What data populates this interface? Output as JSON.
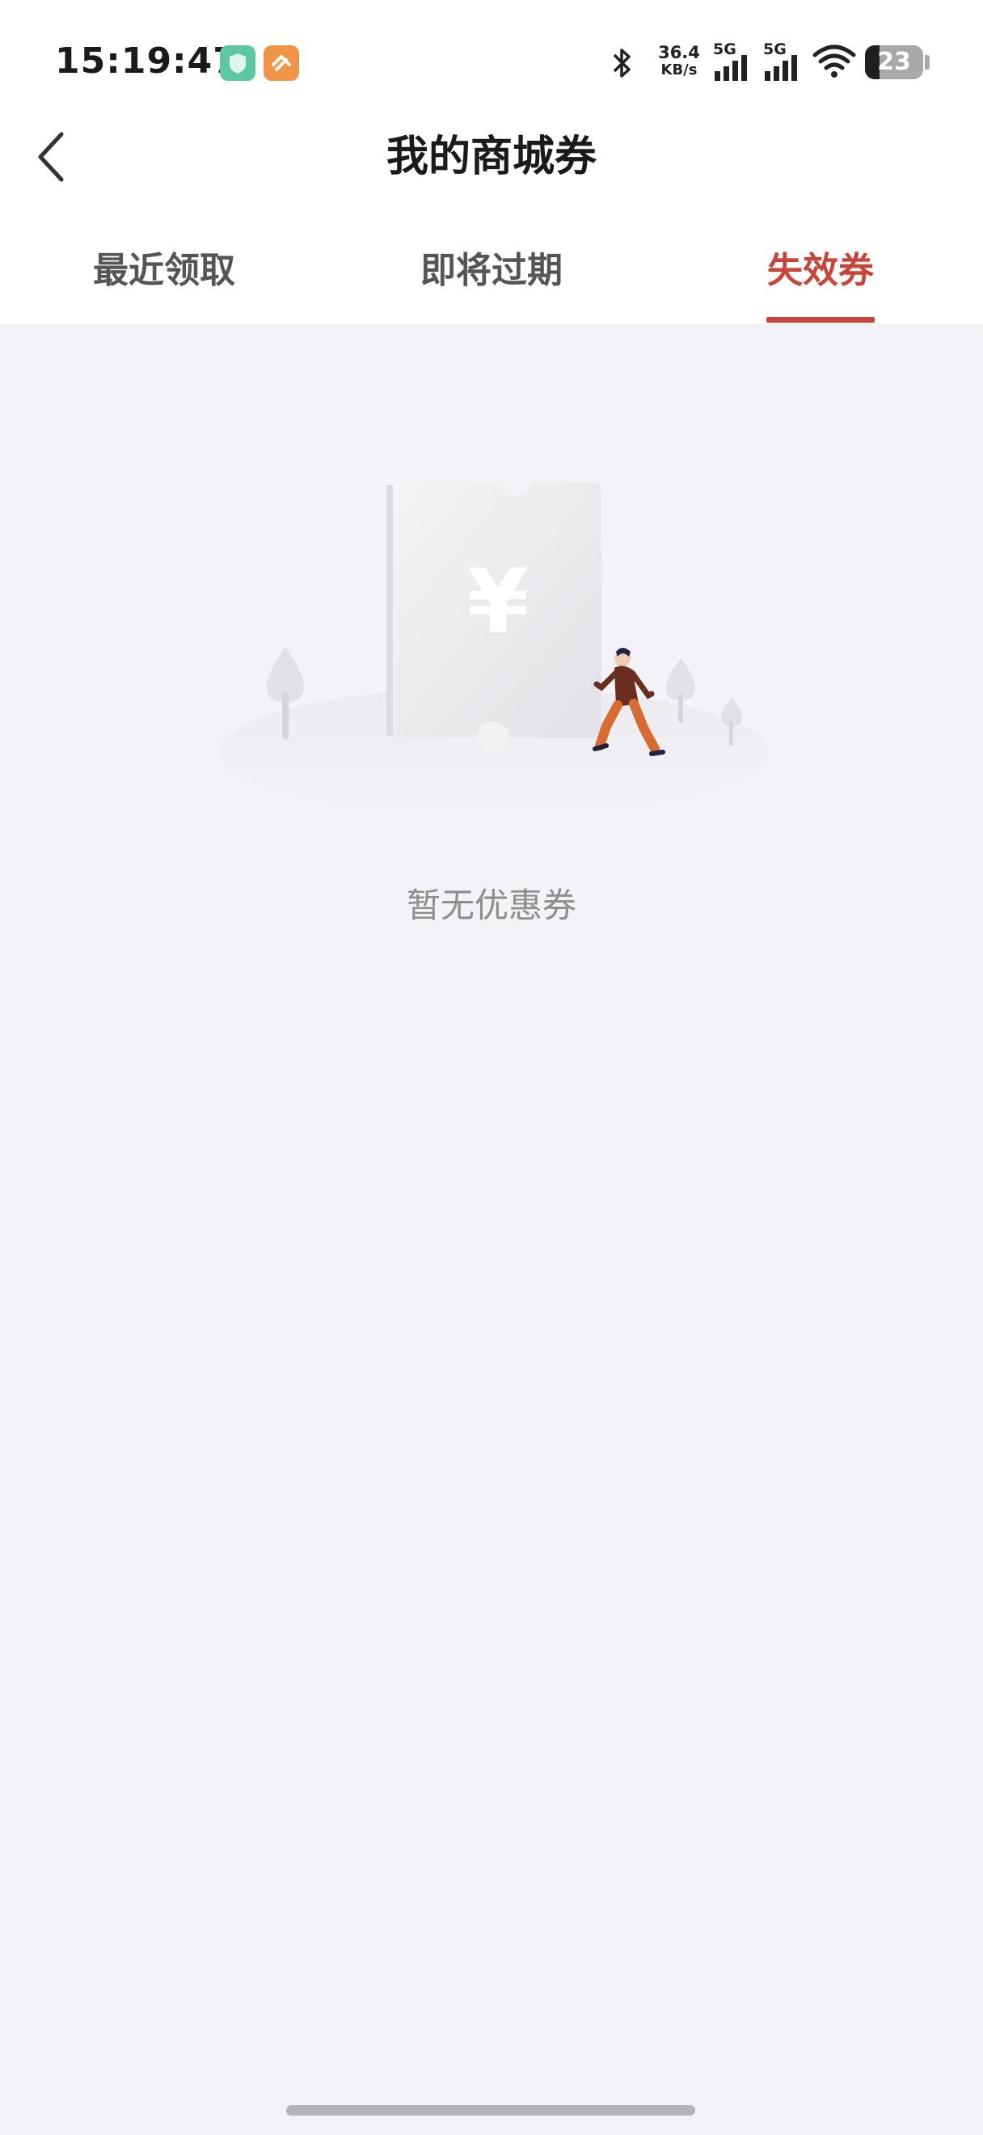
{
  "status_bar": {
    "time": "15:19:47",
    "net_speed_value": "36.4",
    "net_speed_unit": "KB/s",
    "signal_1_label": "5G",
    "signal_2_label": "5G",
    "battery_level": "23",
    "app_badges": [
      "shield-app-icon",
      "health-app-icon"
    ]
  },
  "header": {
    "title": "我的商城券",
    "back_icon": "chevron-left-icon"
  },
  "tabs": [
    {
      "label": "最近领取",
      "active": false
    },
    {
      "label": "即将过期",
      "active": false
    },
    {
      "label": "失效券",
      "active": true
    }
  ],
  "empty_state": {
    "illustration_symbol": "¥",
    "message": "暂无优惠券"
  },
  "colors": {
    "accent": "#c8433a",
    "background": "#f3f2f7",
    "header_bg": "#ffffff",
    "tab_inactive": "#555555",
    "empty_text": "#8e8e8e"
  }
}
